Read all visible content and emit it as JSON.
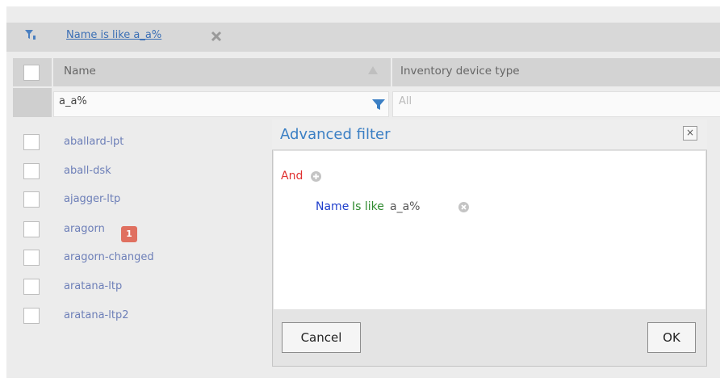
{
  "filter_bar": {
    "active_filter_label": "Name is like a_a%"
  },
  "grid": {
    "columns": [
      "Name",
      "Inventory device type"
    ],
    "filter_row": {
      "name_value": "a_a%",
      "type_placeholder": "All"
    },
    "rows": [
      {
        "name": "aballard-lpt"
      },
      {
        "name": "aball-dsk"
      },
      {
        "name": "ajagger-ltp"
      },
      {
        "name": "aragorn",
        "badge": "1"
      },
      {
        "name": "aragorn-changed"
      },
      {
        "name": "aratana-ltp"
      },
      {
        "name": "aratana-ltp2"
      }
    ]
  },
  "dialog": {
    "title": "Advanced filter",
    "close_glyph": "×",
    "group_operator": "And",
    "condition": {
      "field": "Name",
      "operator": "Is like",
      "value": "a_a%"
    },
    "cancel_label": "Cancel",
    "ok_label": "OK"
  },
  "colors": {
    "link": "#3b6fb5",
    "title": "#3b7fc4",
    "and": "#e03030",
    "field": "#1f3fcc",
    "operator": "#2f8a2f",
    "badge": "#e07060"
  }
}
